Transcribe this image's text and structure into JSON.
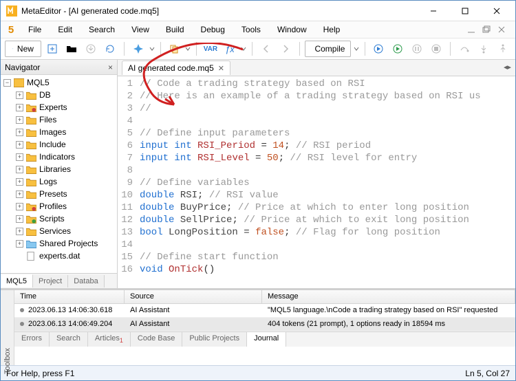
{
  "title": "MetaEditor - [AI generated code.mq5]",
  "menu": [
    "File",
    "Edit",
    "Search",
    "View",
    "Build",
    "Debug",
    "Tools",
    "Window",
    "Help"
  ],
  "toolbar": {
    "new": "New",
    "compile": "Compile",
    "var": "VAR",
    "fx": "ƒx"
  },
  "navigator": {
    "title": "Navigator",
    "root": "MQL5",
    "items": [
      "DB",
      "Experts",
      "Files",
      "Images",
      "Include",
      "Indicators",
      "Libraries",
      "Logs",
      "Presets",
      "Profiles",
      "Scripts",
      "Services",
      "Shared Projects",
      "experts.dat"
    ],
    "tabs": [
      "MQL5",
      "Project",
      "Databa"
    ]
  },
  "file_tab": {
    "name": "AI generated code.mq5"
  },
  "code": [
    {
      "n": 1,
      "segs": [
        [
          "cm",
          "// Code a trading strategy based on RSI"
        ]
      ]
    },
    {
      "n": 2,
      "segs": [
        [
          "cm",
          "// Here is an example of a trading strategy based on RSI us"
        ]
      ]
    },
    {
      "n": 3,
      "segs": [
        [
          "cm",
          "//"
        ]
      ]
    },
    {
      "n": 4,
      "segs": []
    },
    {
      "n": 5,
      "segs": [
        [
          "cm",
          "// Define input parameters"
        ]
      ]
    },
    {
      "n": 6,
      "segs": [
        [
          "kw",
          "input "
        ],
        [
          "kw",
          "int "
        ],
        [
          "fn",
          "RSI_Period"
        ],
        [
          "tx",
          " = "
        ],
        [
          "num",
          "14"
        ],
        [
          "tx",
          "; "
        ],
        [
          "cm",
          "// RSI period"
        ]
      ]
    },
    {
      "n": 7,
      "segs": [
        [
          "kw",
          "input "
        ],
        [
          "kw",
          "int "
        ],
        [
          "fn",
          "RSI_Level"
        ],
        [
          "tx",
          " = "
        ],
        [
          "num",
          "50"
        ],
        [
          "tx",
          "; "
        ],
        [
          "cm",
          "// RSI level for entry"
        ]
      ]
    },
    {
      "n": 8,
      "segs": []
    },
    {
      "n": 9,
      "segs": [
        [
          "cm",
          "// Define variables"
        ]
      ]
    },
    {
      "n": 10,
      "segs": [
        [
          "kw",
          "double "
        ],
        [
          "var",
          "RSI"
        ],
        [
          "tx",
          "; "
        ],
        [
          "cm",
          "// RSI value"
        ]
      ]
    },
    {
      "n": 11,
      "segs": [
        [
          "kw",
          "double "
        ],
        [
          "var",
          "BuyPrice"
        ],
        [
          "tx",
          "; "
        ],
        [
          "cm",
          "// Price at which to enter long position"
        ]
      ]
    },
    {
      "n": 12,
      "segs": [
        [
          "kw",
          "double "
        ],
        [
          "var",
          "SellPrice"
        ],
        [
          "tx",
          "; "
        ],
        [
          "cm",
          "// Price at which to exit long position"
        ]
      ]
    },
    {
      "n": 13,
      "segs": [
        [
          "kw",
          "bool "
        ],
        [
          "var",
          "LongPosition"
        ],
        [
          "tx",
          " = "
        ],
        [
          "fl",
          "false"
        ],
        [
          "tx",
          "; "
        ],
        [
          "cm",
          "// Flag for long position"
        ]
      ]
    },
    {
      "n": 14,
      "segs": []
    },
    {
      "n": 15,
      "segs": [
        [
          "cm",
          "// Define start function"
        ]
      ]
    },
    {
      "n": 16,
      "segs": [
        [
          "kw",
          "void "
        ],
        [
          "fn",
          "OnTick"
        ],
        [
          "tx",
          "()"
        ]
      ]
    }
  ],
  "log": {
    "headers": [
      "Time",
      "Source",
      "Message"
    ],
    "rows": [
      {
        "time": "2023.06.13 14:06:30.618",
        "src": "AI Assistant",
        "msg": "\"MQL5 language.\\nCode a trading strategy based on RSI\" requested"
      },
      {
        "time": "2023.06.13 14:06:49.204",
        "src": "AI Assistant",
        "msg": "404 tokens (21 prompt), 1 options ready in 18594 ms"
      }
    ]
  },
  "btabs": [
    "Errors",
    "Search",
    "Articles",
    "Code Base",
    "Public Projects",
    "Journal"
  ],
  "toolbox": "Toolbox",
  "status": {
    "left": "For Help, press F1",
    "right": "Ln 5, Col 27"
  }
}
